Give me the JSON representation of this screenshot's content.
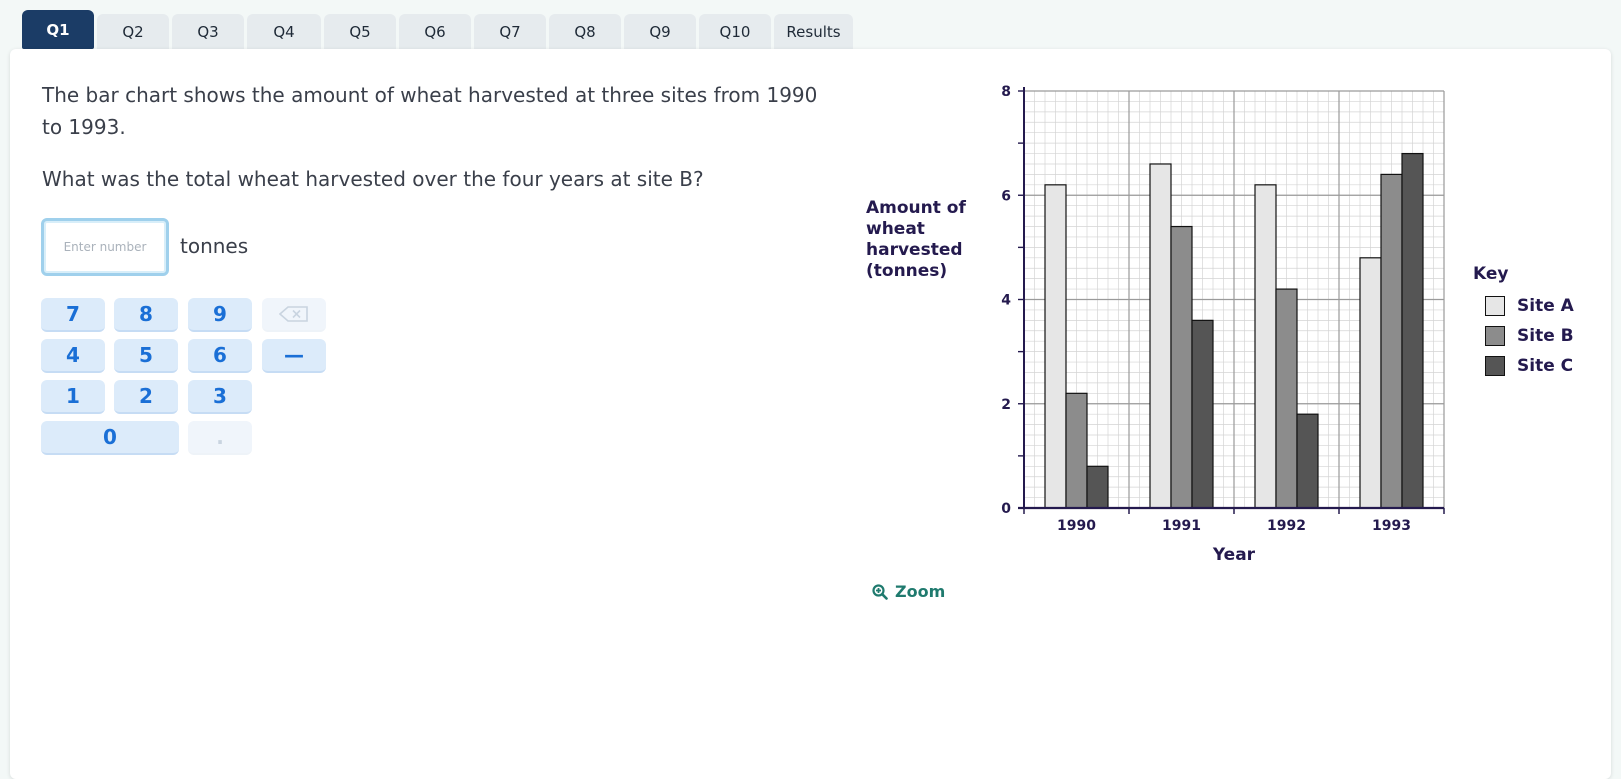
{
  "tabs": [
    "Q1",
    "Q2",
    "Q3",
    "Q4",
    "Q5",
    "Q6",
    "Q7",
    "Q8",
    "Q9",
    "Q10",
    "Results"
  ],
  "question": {
    "line1": "The bar chart shows the amount of wheat harvested at three sites from 1990 to 1993.",
    "line2": "What was the total wheat harvested over the four years at site B?"
  },
  "answer": {
    "placeholder": "Enter number",
    "value": "",
    "unit": "tonnes"
  },
  "keypad": {
    "keys": [
      "7",
      "8",
      "9",
      "⌫",
      "4",
      "5",
      "6",
      "—",
      "1",
      "2",
      "3",
      "0",
      "."
    ],
    "disabled": [
      "⌫",
      "."
    ]
  },
  "zoom_label": "Zoom",
  "colors": {
    "tab_active": "#1b3c66",
    "key_bg": "#dcebfa",
    "key_text": "#1a6fd6",
    "zoom": "#1f7a6e"
  },
  "chart_data": {
    "type": "bar",
    "categories": [
      "1990",
      "1991",
      "1992",
      "1993"
    ],
    "series": [
      {
        "name": "Site A",
        "color": "#e6e6e6",
        "values": [
          6.2,
          6.6,
          6.2,
          4.8
        ]
      },
      {
        "name": "Site B",
        "color": "#8c8c8c",
        "values": [
          2.2,
          5.4,
          4.2,
          6.4
        ]
      },
      {
        "name": "Site C",
        "color": "#555555",
        "values": [
          0.8,
          3.6,
          1.8,
          6.8
        ]
      }
    ],
    "xlabel": "Year",
    "ylabel": "Amount of wheat harvested (tonnes)",
    "ylabel_lines": [
      "Amount of",
      "wheat",
      "harvested",
      "(tonnes)"
    ],
    "ylim": [
      0,
      8
    ],
    "yticks": [
      0,
      2,
      4,
      6,
      8
    ],
    "grid": true,
    "legend_title": "Key",
    "legend_position": "right"
  }
}
